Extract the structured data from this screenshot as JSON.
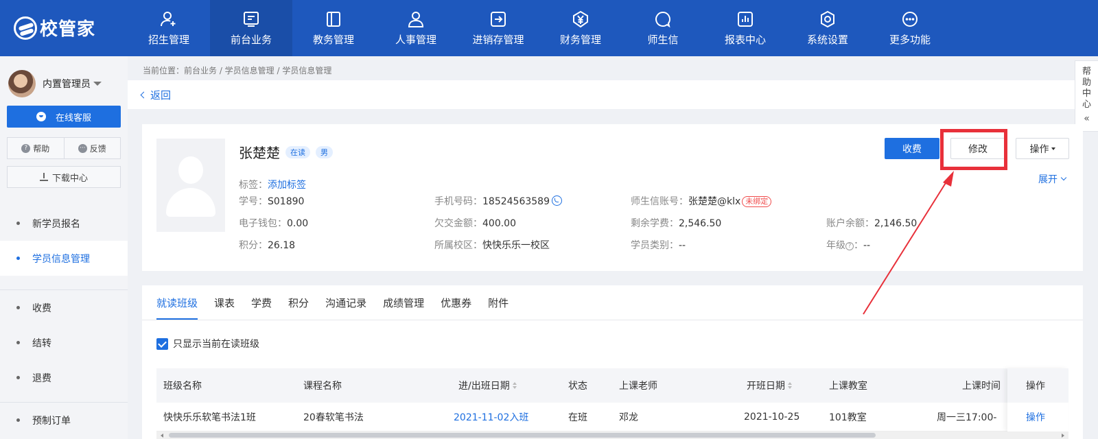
{
  "app": {
    "logo_text": "校管家"
  },
  "nav": [
    {
      "label": "招生管理",
      "icon": "user-plus-icon"
    },
    {
      "label": "前台业务",
      "icon": "monitor-icon",
      "active": true
    },
    {
      "label": "教务管理",
      "icon": "book-icon"
    },
    {
      "label": "人事管理",
      "icon": "user-icon"
    },
    {
      "label": "进销存管理",
      "icon": "box-arrow-icon"
    },
    {
      "label": "财务管理",
      "icon": "yen-icon"
    },
    {
      "label": "师生信",
      "icon": "chat-icon"
    },
    {
      "label": "报表中心",
      "icon": "bar-chart-icon"
    },
    {
      "label": "系统设置",
      "icon": "settings-icon"
    },
    {
      "label": "更多功能",
      "icon": "more-icon"
    }
  ],
  "sidebar": {
    "user_name": "内置管理员",
    "service_label": "在线客服",
    "help_label": "帮助",
    "feedback_label": "反馈",
    "download_label": "下载中心",
    "items": [
      {
        "label": "新学员报名"
      },
      {
        "label": "学员信息管理",
        "active": true
      },
      {
        "label": "收费"
      },
      {
        "label": "结转"
      },
      {
        "label": "退费"
      },
      {
        "label": "预制订单"
      }
    ]
  },
  "breadcrumb": "当前位置：前台业务 / 学员信息管理 / 学员信息管理",
  "back_label": "返回",
  "help_center": {
    "label": "帮助中心",
    "collapse_glyph": "«"
  },
  "student": {
    "name": "张楚楚",
    "status_badge": "在读",
    "gender_badge": "男",
    "tag_label": "标签：",
    "tag_link": "添加标签",
    "fields": {
      "student_no_label": "学号：",
      "student_no": "S01890",
      "phone_label": "手机号码：",
      "phone": "18524563589",
      "account_label": "师生信账号：",
      "account": "张楚楚@klx",
      "account_status": "未绑定",
      "wallet_label": "电子钱包：",
      "wallet": "0.00",
      "owed_label": "欠交金额：",
      "owed": "400.00",
      "remaining_label": "剩余学费：",
      "remaining": "2,546.50",
      "balance_label": "账户余额：",
      "balance": "2,146.50",
      "points_label": "积分：",
      "points": "26.18",
      "campus_label": "所属校区：",
      "campus": "快快乐乐一校区",
      "category_label": "学员类别：",
      "category": "--",
      "grade_label": "年级",
      "grade_suffix": "：",
      "grade": "--"
    },
    "buttons": {
      "charge": "收费",
      "edit": "修改",
      "ops": "操作",
      "expand": "展开"
    }
  },
  "tabs": [
    "就读班级",
    "课表",
    "学费",
    "积分",
    "沟通记录",
    "成绩管理",
    "优惠券",
    "附件"
  ],
  "filter_label": "只显示当前在读班级",
  "table": {
    "headers": [
      "班级名称",
      "课程名称",
      "进/出班日期",
      "状态",
      "上课老师",
      "开班日期",
      "上课教室",
      "上课时间",
      "操作"
    ],
    "rows": [
      [
        "快快乐乐软笔书法1班",
        "20春软笔书法",
        "2021-11-02入班",
        "在班",
        "邓龙",
        "2021-10-25",
        "101教室",
        "周一三17:00-",
        "操作"
      ]
    ]
  },
  "colors": {
    "nav_bg": "#1e58bd",
    "accent": "#1e6fe0",
    "highlight": "#e8303a"
  }
}
